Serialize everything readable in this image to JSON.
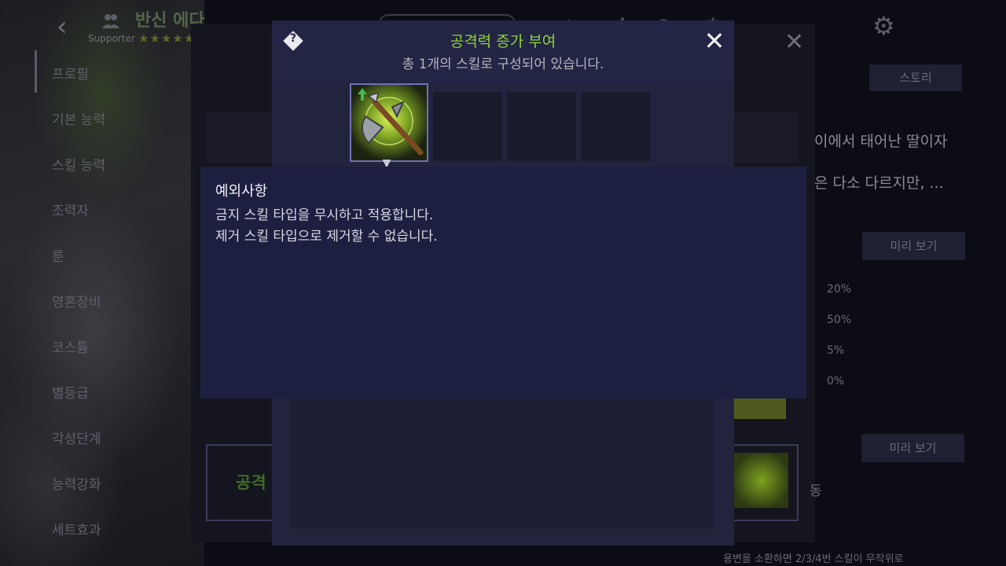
{
  "header": {
    "back_glyph": "‹",
    "supporter_label": "Supporter",
    "character_name": "반신 에다",
    "stars": "★★★★★"
  },
  "sidebar": {
    "items": [
      {
        "label": "프로필"
      },
      {
        "label": "기본 능력"
      },
      {
        "label": "스킬 능력"
      },
      {
        "label": "조력자"
      },
      {
        "label": "룬"
      },
      {
        "label": "영혼장비"
      },
      {
        "label": "코스튬"
      },
      {
        "label": "별등급"
      },
      {
        "label": "각성단계"
      },
      {
        "label": "능력강화"
      },
      {
        "label": "세트효과"
      }
    ]
  },
  "background_panel": {
    "story_button": "스토리",
    "story_line1": "이에서 태어난 딸이자",
    "story_line2": "은 다소 다르지만, ...",
    "preview_button_1": "미리 보기",
    "preview_button_2": "미리 보기",
    "stats": [
      "20%",
      "50%",
      "5%",
      "0%"
    ],
    "bottom_label": "공격",
    "bottom_text": "용변을 소환하면 2/3/4번 스킬이 무작위로",
    "side_char": "동"
  },
  "dialog": {
    "title": "공격력 증가 부여",
    "subtitle": "총 1개의 스킬로 구성되어 있습니다.",
    "help_icon": "?",
    "close_glyph": "✕",
    "skill_slots": [
      {
        "icon": "axe-skill-icon",
        "selected": true
      },
      {
        "icon": "",
        "selected": false
      },
      {
        "icon": "",
        "selected": false
      },
      {
        "icon": "",
        "selected": false
      }
    ]
  },
  "tooltip": {
    "title": "예외사항",
    "lines": [
      "금지 스킬 타입을 무시하고 적용합니다.",
      "제거 스킬 타입으로 제거할 수 없습니다."
    ]
  },
  "colors": {
    "title_green": "#8fd33a",
    "dialog_bg": "#22243d",
    "tooltip_bg": "#1d1f40"
  }
}
